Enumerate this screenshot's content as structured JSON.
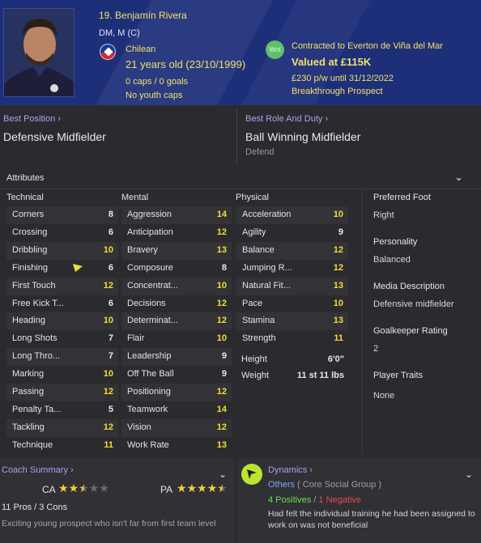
{
  "header": {
    "name": "19. Benjamín Rivera",
    "positions": "DM, M (C)",
    "nationality": "Chilean",
    "age": "21 years old (23/10/1999)",
    "caps": "0 caps / 0 goals",
    "youth_caps": "No youth caps",
    "status_badge": "Wnt",
    "contract": "Contracted to Everton de Viña del Mar",
    "value": "Valued at £115K",
    "wage": "£230 p/w until 31/12/2022",
    "prospect": "Breakthrough Prospect"
  },
  "best_position": {
    "label": "Best Position",
    "value": "Defensive Midfielder"
  },
  "best_role": {
    "label": "Best Role And Duty",
    "value": "Ball Winning Midfielder",
    "duty": "Defend"
  },
  "attributes": {
    "title": "Attributes",
    "technical_header": "Technical",
    "mental_header": "Mental",
    "physical_header": "Physical",
    "technical": [
      {
        "label": "Corners",
        "value": "8"
      },
      {
        "label": "Crossing",
        "value": "6"
      },
      {
        "label": "Dribbling",
        "value": "10"
      },
      {
        "label": "Finishing",
        "value": "6"
      },
      {
        "label": "First Touch",
        "value": "12"
      },
      {
        "label": "Free Kick T...",
        "value": "6"
      },
      {
        "label": "Heading",
        "value": "10"
      },
      {
        "label": "Long Shots",
        "value": "7"
      },
      {
        "label": "Long Thro...",
        "value": "7"
      },
      {
        "label": "Marking",
        "value": "10"
      },
      {
        "label": "Passing",
        "value": "12"
      },
      {
        "label": "Penalty Ta...",
        "value": "5"
      },
      {
        "label": "Tackling",
        "value": "12"
      },
      {
        "label": "Technique",
        "value": "11"
      }
    ],
    "mental": [
      {
        "label": "Aggression",
        "value": "14"
      },
      {
        "label": "Anticipation",
        "value": "12"
      },
      {
        "label": "Bravery",
        "value": "13"
      },
      {
        "label": "Composure",
        "value": "8"
      },
      {
        "label": "Concentrat...",
        "value": "10"
      },
      {
        "label": "Decisions",
        "value": "12"
      },
      {
        "label": "Determinat...",
        "value": "12"
      },
      {
        "label": "Flair",
        "value": "10"
      },
      {
        "label": "Leadership",
        "value": "9"
      },
      {
        "label": "Off The Ball",
        "value": "9"
      },
      {
        "label": "Positioning",
        "value": "12"
      },
      {
        "label": "Teamwork",
        "value": "14"
      },
      {
        "label": "Vision",
        "value": "12"
      },
      {
        "label": "Work Rate",
        "value": "13"
      }
    ],
    "physical": [
      {
        "label": "Acceleration",
        "value": "10"
      },
      {
        "label": "Agility",
        "value": "9"
      },
      {
        "label": "Balance",
        "value": "12"
      },
      {
        "label": "Jumping R...",
        "value": "12"
      },
      {
        "label": "Natural Fit...",
        "value": "13"
      },
      {
        "label": "Pace",
        "value": "10"
      },
      {
        "label": "Stamina",
        "value": "13"
      },
      {
        "label": "Strength",
        "value": "11"
      }
    ],
    "height_label": "Height",
    "height": "6'0\"",
    "weight_label": "Weight",
    "weight": "11 st 11 lbs"
  },
  "side": {
    "preferred_foot_label": "Preferred Foot",
    "preferred_foot": "Right",
    "personality_label": "Personality",
    "personality": "Balanced",
    "media_label": "Media Description",
    "media": "Defensive midfielder",
    "gk_label": "Goalkeeper Rating",
    "gk": "2",
    "traits_label": "Player Traits",
    "traits": "None"
  },
  "coach": {
    "title": "Coach Summary",
    "ca_label": "CA",
    "ca_stars": 2.5,
    "pa_label": "PA",
    "pa_stars": 4.5,
    "pros_cons": "11 Pros / 3 Cons",
    "summary": "Exciting young prospect who isn't far from first team level"
  },
  "dynamics": {
    "title": "Dynamics",
    "group": "Others",
    "group_detail": "( Core Social Group )",
    "positives": "4 Positives",
    "separator": "/",
    "negatives": "1 Negative",
    "message": "Had felt the individual training he had been assigned to work on was not beneficial"
  },
  "colors": {
    "header_bg": "#1e2f7a",
    "highlight_value": "#f2de36",
    "link": "#a6a4ec",
    "positive": "#6ddd55",
    "negative": "#e14b4b"
  }
}
